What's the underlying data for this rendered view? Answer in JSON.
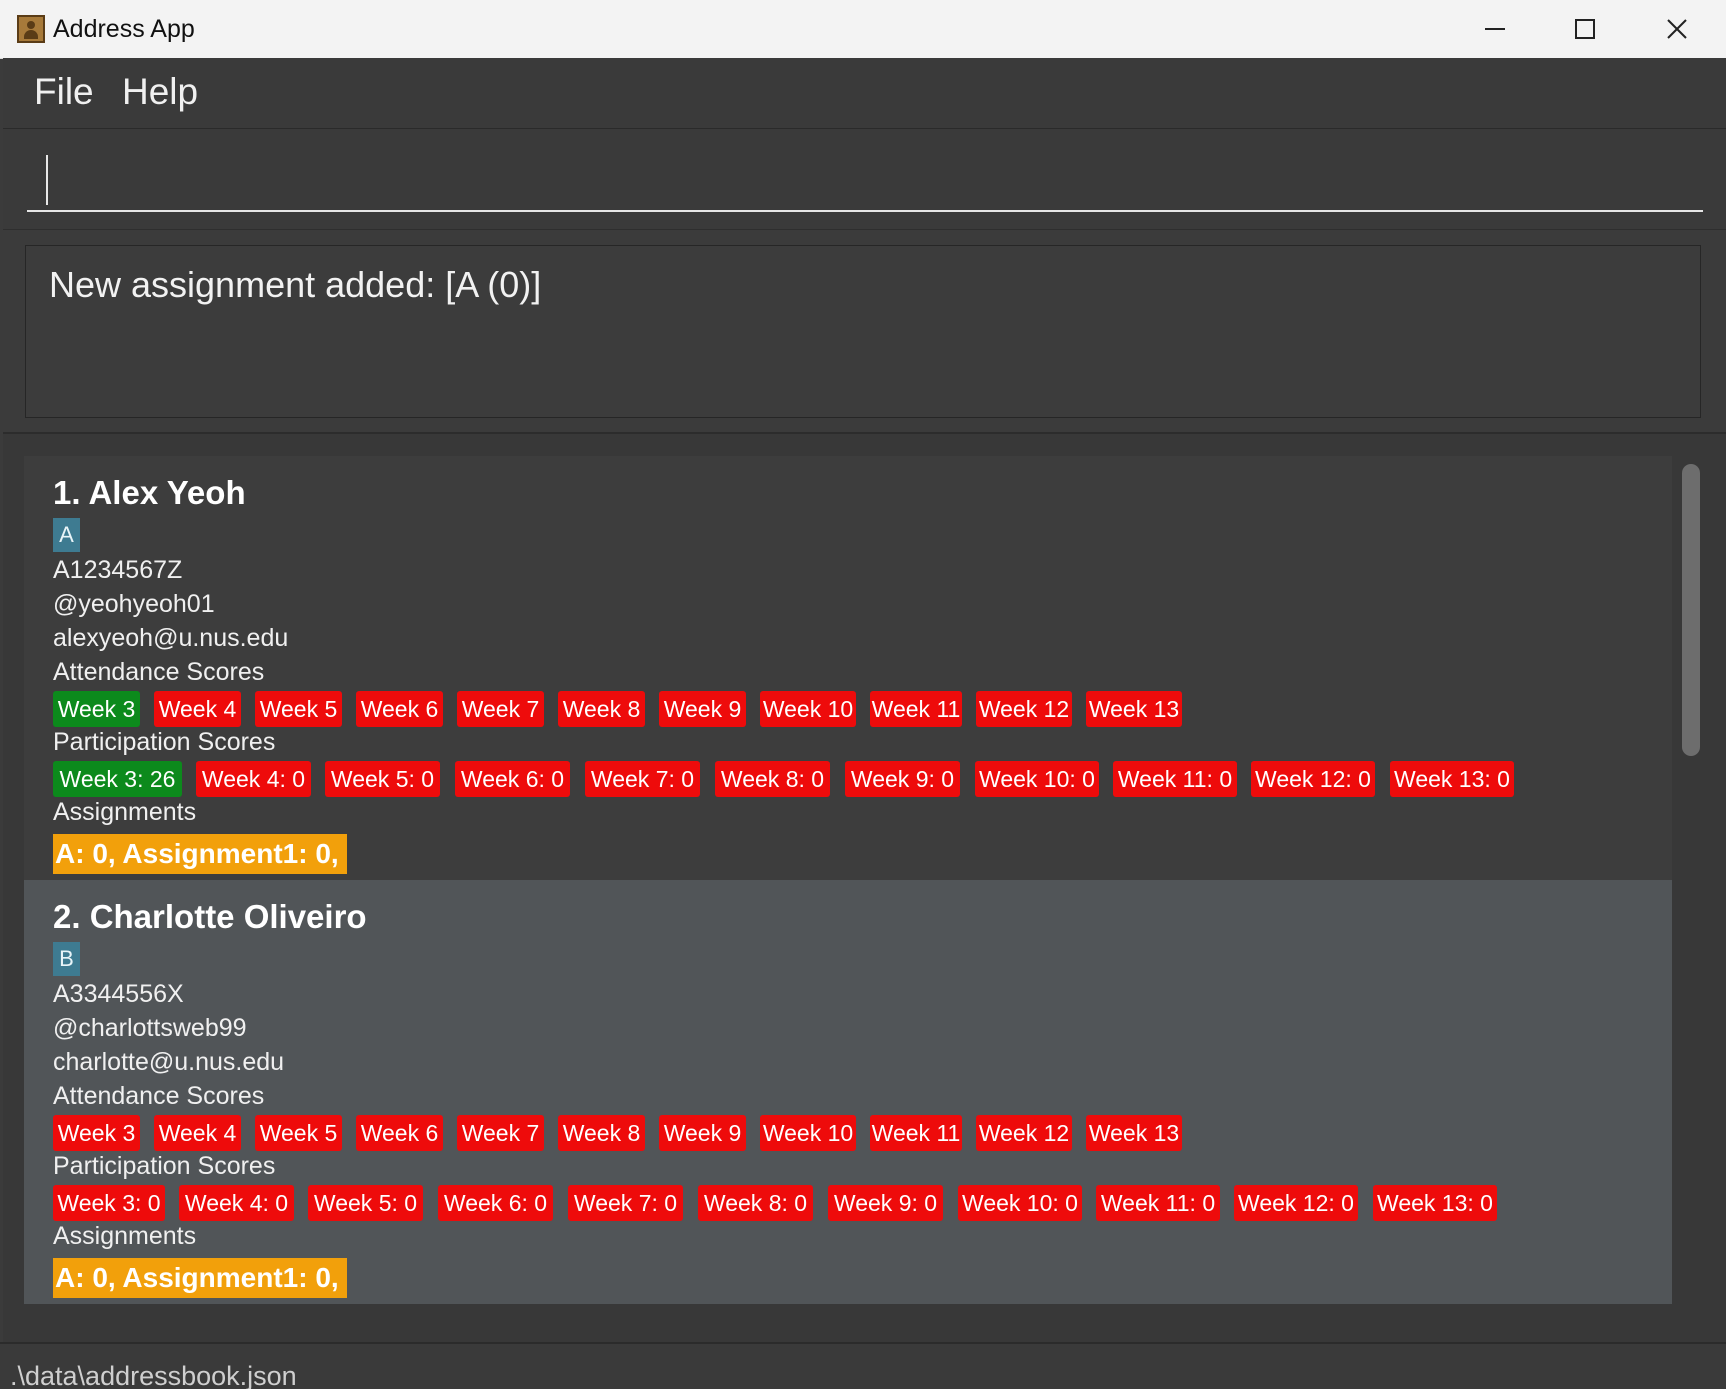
{
  "window": {
    "title": "Address App",
    "icon": "address-book-icon"
  },
  "menu": {
    "file": "File",
    "help": "Help"
  },
  "command": {
    "value": "",
    "placeholder": ""
  },
  "result": {
    "message": "New assignment added: [A (0)]"
  },
  "persons": [
    {
      "name": "1.  Alex Yeoh",
      "group": "A",
      "student_id": "A1234567Z",
      "telegram": "@yeohyeoh01",
      "email": "alexyeoh@u.nus.edu",
      "attendance_label": "Attendance Scores",
      "attendance": [
        "Week 3",
        "Week 4",
        "Week 5",
        "Week 6",
        "Week 7",
        "Week 8",
        "Week 9",
        "Week 10",
        "Week 11",
        "Week 12",
        "Week 13"
      ],
      "attendance_status": [
        "present",
        "absent",
        "absent",
        "absent",
        "absent",
        "absent",
        "absent",
        "absent",
        "absent",
        "absent",
        "absent"
      ],
      "participation_label": "Participation Scores",
      "participation": [
        "Week 3: 26",
        "Week 4: 0",
        "Week 5: 0",
        "Week 6: 0",
        "Week 7: 0",
        "Week 8: 0",
        "Week 9: 0",
        "Week 10: 0",
        "Week 11: 0",
        "Week 12: 0",
        "Week 13: 0"
      ],
      "participation_status": [
        "scored",
        "zero",
        "zero",
        "zero",
        "zero",
        "zero",
        "zero",
        "zero",
        "zero",
        "zero",
        "zero"
      ],
      "assignments_label": "Assignments",
      "assignments": "A: 0, Assignment1: 0,"
    },
    {
      "name": "2.  Charlotte Oliveiro",
      "group": "B",
      "student_id": "A3344556X",
      "telegram": "@charlottsweb99",
      "email": "charlotte@u.nus.edu",
      "attendance_label": "Attendance Scores",
      "attendance": [
        "Week 3",
        "Week 4",
        "Week 5",
        "Week 6",
        "Week 7",
        "Week 8",
        "Week 9",
        "Week 10",
        "Week 11",
        "Week 12",
        "Week 13"
      ],
      "attendance_status": [
        "absent",
        "absent",
        "absent",
        "absent",
        "absent",
        "absent",
        "absent",
        "absent",
        "absent",
        "absent",
        "absent"
      ],
      "participation_label": "Participation Scores",
      "participation": [
        "Week 3: 0",
        "Week 4: 0",
        "Week 5: 0",
        "Week 6: 0",
        "Week 7: 0",
        "Week 8: 0",
        "Week 9: 0",
        "Week 10: 0",
        "Week 11: 0",
        "Week 12: 0",
        "Week 13: 0"
      ],
      "participation_status": [
        "zero",
        "zero",
        "zero",
        "zero",
        "zero",
        "zero",
        "zero",
        "zero",
        "zero",
        "zero",
        "zero"
      ],
      "assignments_label": "Assignments",
      "assignments": "A: 0, Assignment1: 0,"
    }
  ],
  "colors": {
    "present": "#0c8a1c",
    "absent": "#ee0b0b",
    "assignment": "#f2a00b",
    "group_tag": "#3e7b91"
  },
  "status_bar": {
    "path": ".\\data\\addressbook.json"
  }
}
